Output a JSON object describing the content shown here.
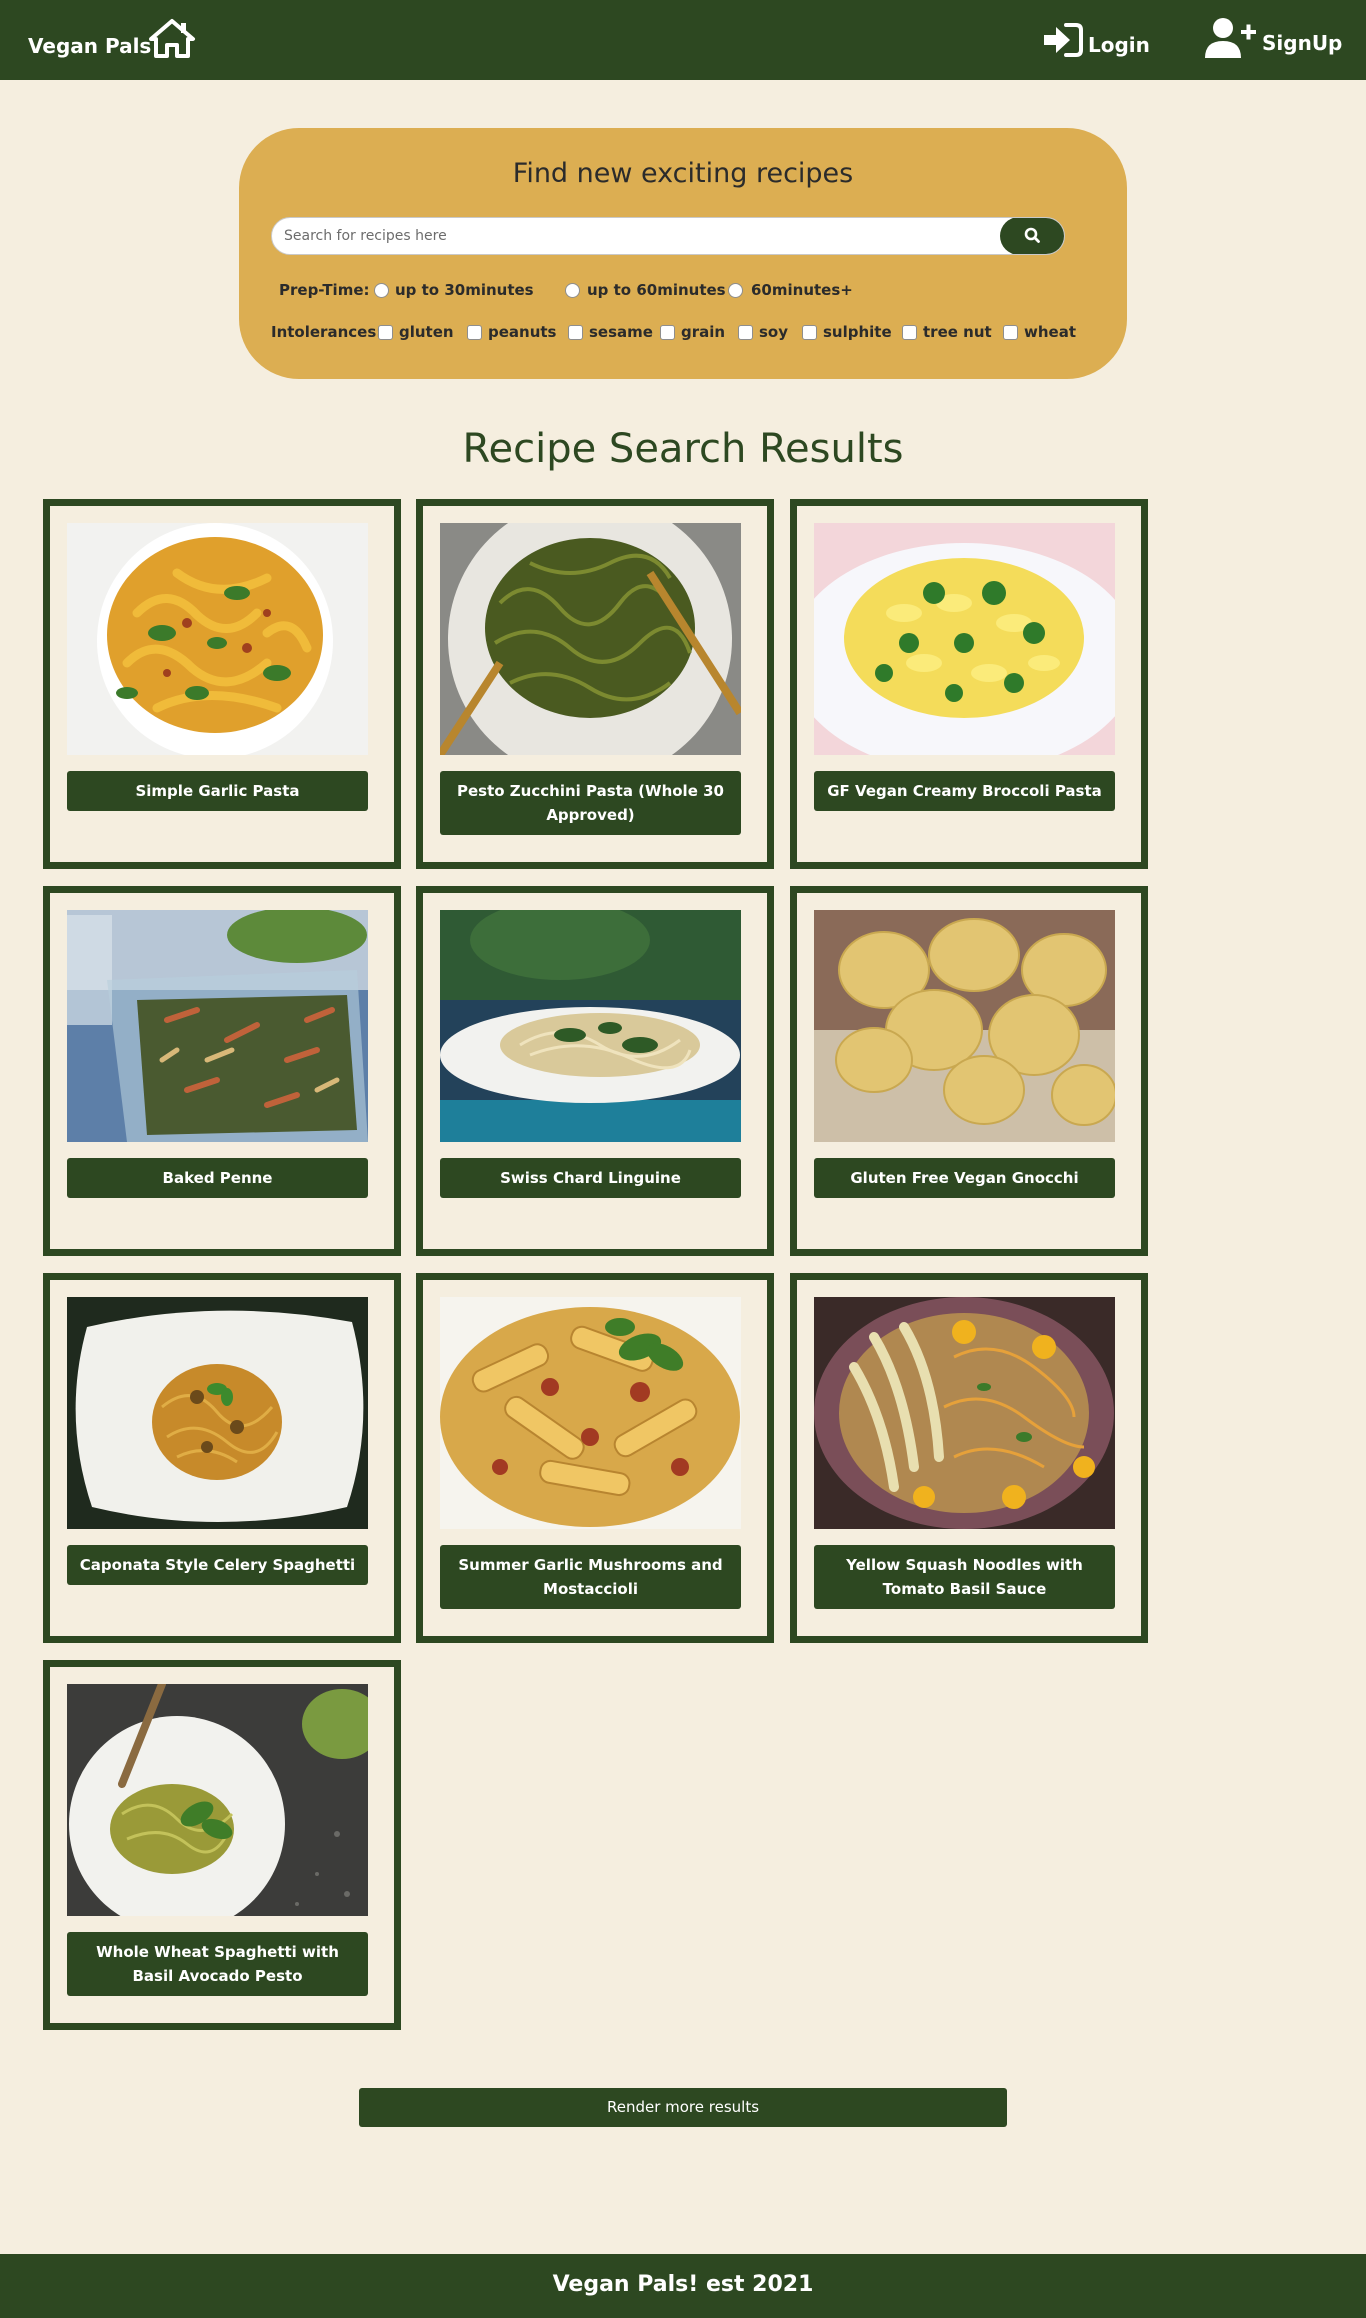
{
  "navbar": {
    "brand": "Vegan Pals",
    "login_label": "Login",
    "signup_label": "SignUp"
  },
  "search": {
    "title": "Find new exciting recipes",
    "placeholder": "Search for recipes here",
    "prep_label": "Prep-Time:",
    "prep_options": [
      "up to 30minutes",
      "up to 60minutes",
      "60minutes+"
    ],
    "intolerance_label": "Intolerances:",
    "intolerances": [
      "gluten",
      "peanuts",
      "sesame",
      "grain",
      "soy",
      "sulphite",
      "tree nut",
      "wheat"
    ]
  },
  "results": {
    "title": "Recipe Search Results",
    "recipes": [
      "Simple Garlic Pasta",
      "Pesto Zucchini Pasta (Whole 30 Approved)",
      "GF Vegan Creamy Broccoli Pasta",
      "Baked Penne",
      "Swiss Chard Linguine",
      "Gluten Free Vegan Gnocchi",
      "Caponata Style Celery Spaghetti",
      "Summer Garlic Mushrooms and Mostaccioli",
      "Yellow Squash Noodles with Tomato Basil Sauce",
      "Whole Wheat Spaghetti with Basil Avocado Pesto"
    ],
    "more_label": "Render more results"
  },
  "footer": {
    "text": "Vegan Pals! est 2021"
  },
  "colors": {
    "primary": "#2d4821",
    "panel": "#dcae52",
    "background": "#f5eedf"
  }
}
